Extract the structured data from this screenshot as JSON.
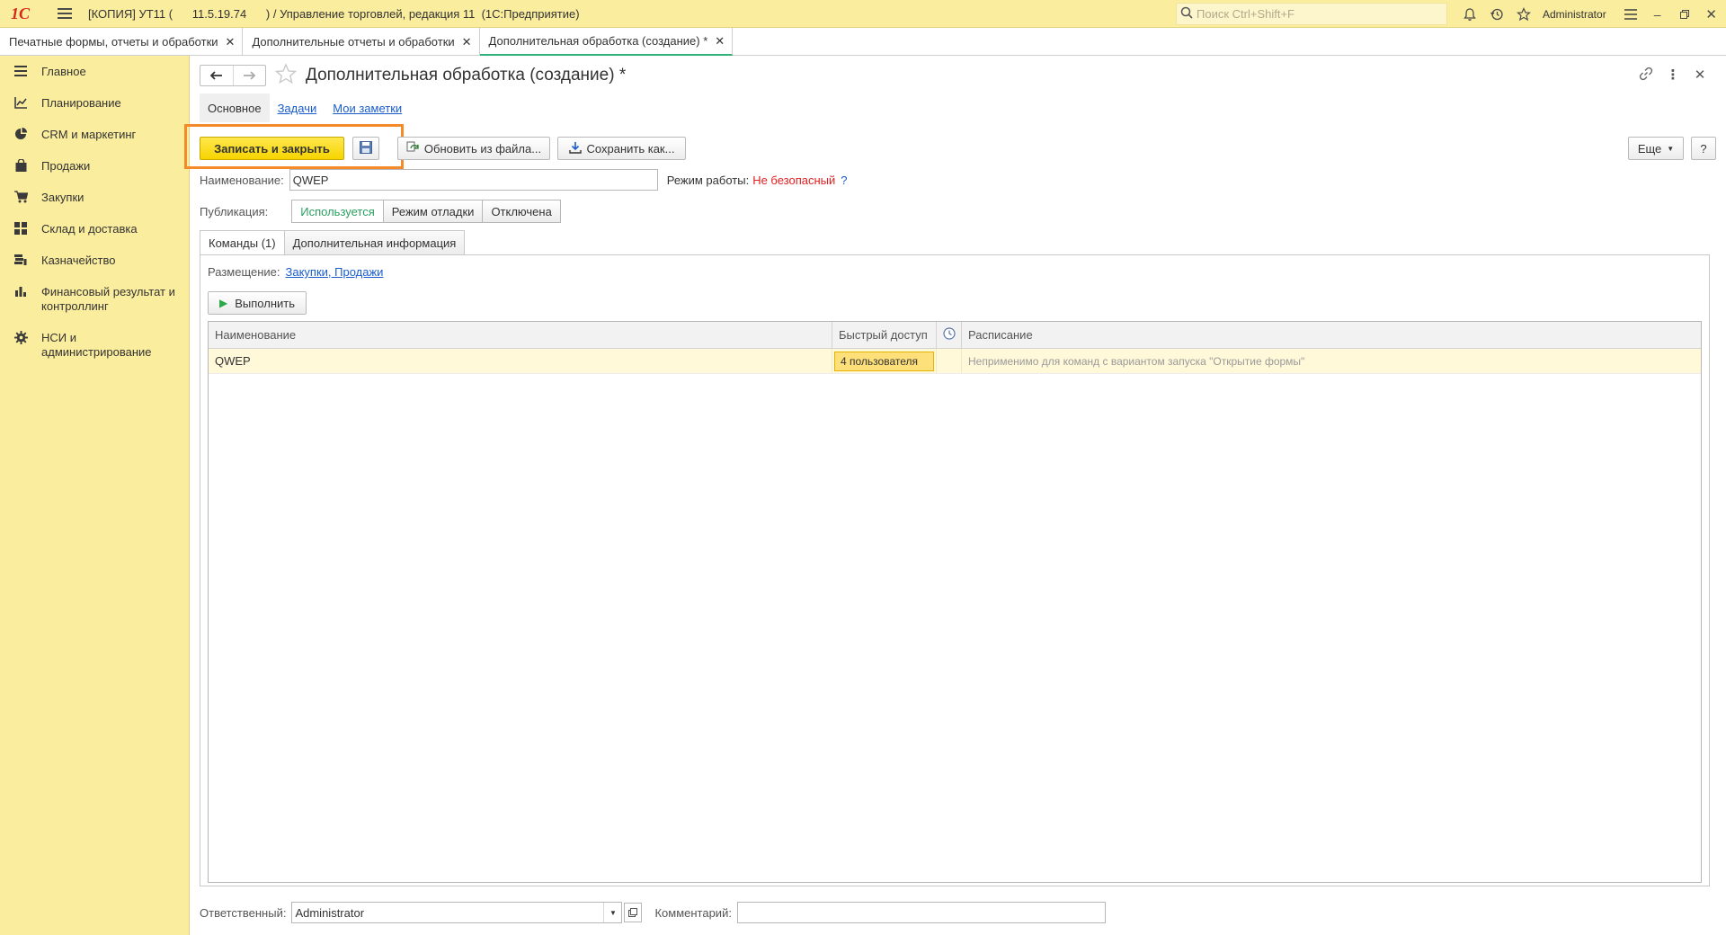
{
  "topbar": {
    "logo": "1С",
    "title": "[КОПИЯ] УТ11 (      11.5.19.74      ) / Управление торговлей, редакция 11  (1С:Предприятие)",
    "search_placeholder": "Поиск Ctrl+Shift+F",
    "user": "Administrator"
  },
  "open_tabs": [
    {
      "label": "Печатные формы, отчеты и обработки"
    },
    {
      "label": "Дополнительные отчеты и обработки"
    },
    {
      "label": "Дополнительная обработка (создание) *"
    }
  ],
  "sidebar": {
    "items": [
      {
        "label": "Главное"
      },
      {
        "label": "Планирование"
      },
      {
        "label": "CRM и маркетинг"
      },
      {
        "label": "Продажи"
      },
      {
        "label": "Закупки"
      },
      {
        "label": "Склад и доставка"
      },
      {
        "label": "Казначейство"
      },
      {
        "label": "Финансовый результат и контроллинг"
      },
      {
        "label": "НСИ и администрирование"
      }
    ]
  },
  "form": {
    "title": "Дополнительная обработка (создание) *",
    "tabs": [
      {
        "label": "Основное"
      },
      {
        "label": "Задачи"
      },
      {
        "label": "Мои заметки"
      }
    ],
    "toolbar": {
      "save_close": "Записать и закрыть",
      "update_from_file": "Обновить из файла...",
      "save_as": "Сохранить как...",
      "more": "Еще",
      "help": "?"
    },
    "name_label": "Наименование:",
    "name_value": "QWEP",
    "mode_label": "Режим работы:",
    "mode_value": "Не безопасный",
    "mode_help": "?",
    "publication_label": "Публикация:",
    "publication_options": [
      {
        "label": "Используется"
      },
      {
        "label": "Режим отладки"
      },
      {
        "label": "Отключена"
      }
    ],
    "panel_tabs": [
      {
        "label": "Команды (1)"
      },
      {
        "label": "Дополнительная информация"
      }
    ],
    "placement_label": "Размещение:",
    "placement_value": "Закупки, Продажи",
    "run_button": "Выполнить",
    "grid": {
      "columns": [
        "Наименование",
        "Быстрый доступ",
        "",
        "Расписание"
      ],
      "rows": [
        {
          "name": "QWEP",
          "quick_access": "4 пользователя",
          "schedule": "Неприменимо для команд с вариантом запуска \"Открытие формы\""
        }
      ]
    },
    "responsible_label": "Ответственный:",
    "responsible_value": "Administrator",
    "comment_label": "Комментарий:",
    "comment_value": ""
  }
}
